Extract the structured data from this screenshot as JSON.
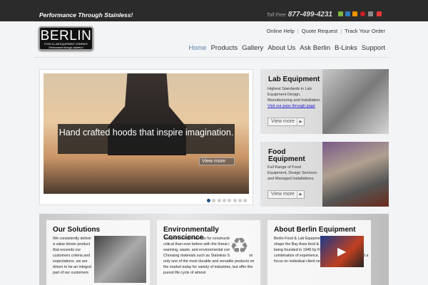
{
  "topbar": {
    "tagline": "Performance Through Stainless!",
    "tollfree_label": "Toll Free",
    "phone": "877-499-4231",
    "social": [
      {
        "icon": "yelp-icon",
        "color": "#7cb342"
      },
      {
        "icon": "linkedin-icon",
        "color": "#2f7bbf"
      },
      {
        "icon": "rss-icon",
        "color": "#f39200"
      },
      {
        "icon": "pinterest-icon",
        "color": "#cb2027"
      },
      {
        "icon": "instagram-icon",
        "color": "#8a8a8a"
      },
      {
        "icon": "youtube-icon",
        "color": "#e53935"
      }
    ]
  },
  "logo": {
    "name": "BERLIN",
    "sub": "FOOD & LAB EQUIPMENT COMPANY",
    "motto": "Performance through stainless!"
  },
  "toplinks": [
    "Online Help",
    "Quote Request",
    "Track Your Order"
  ],
  "nav": [
    "Home",
    "Products",
    "Gallery",
    "About Us",
    "Ask Berlin",
    "B-Links",
    "Support"
  ],
  "slider": {
    "caption": "Hand crafted hoods that inspire imagination.",
    "view_more": "View more",
    "slide_count": 8,
    "active_slide": 1
  },
  "cards": [
    {
      "title": "Lab Equipment",
      "text": "Highest Standards in Lab Equipment Design, Manufacturing and Installation.",
      "link": "Visit our pass through page",
      "view_more": "View more"
    },
    {
      "title": "Food Equipment",
      "text": "Full Range of Food Equipment, Design Services and Managed Installations.",
      "view_more": "View more"
    }
  ],
  "panels": [
    {
      "title": "Our Solutions",
      "text": "We consistently deliver a value driven product that exceeds our customers criteria and expectations. we are driven to be an integral part of our customers"
    },
    {
      "title": "Environmentally Conscience",
      "text": "Today choosing materials for construction are more critical than ever before with the threat of global warming, waste, and environmental contamination. Choosing materials such as Stainless Steels offer not only one of the most durable and versatile products on the market today for variety of industries, but offer the purest life cycle of almost"
    },
    {
      "title": "About Berlin Equipment",
      "text": "Berlin Food & Lab Equipment Company has helped shape the Bay Area food & Lab service industry since being founded in 1945 by Fred J. Berlin. Today, the combination of experience, strict attention to detail and a focus on individual client needs places"
    }
  ]
}
